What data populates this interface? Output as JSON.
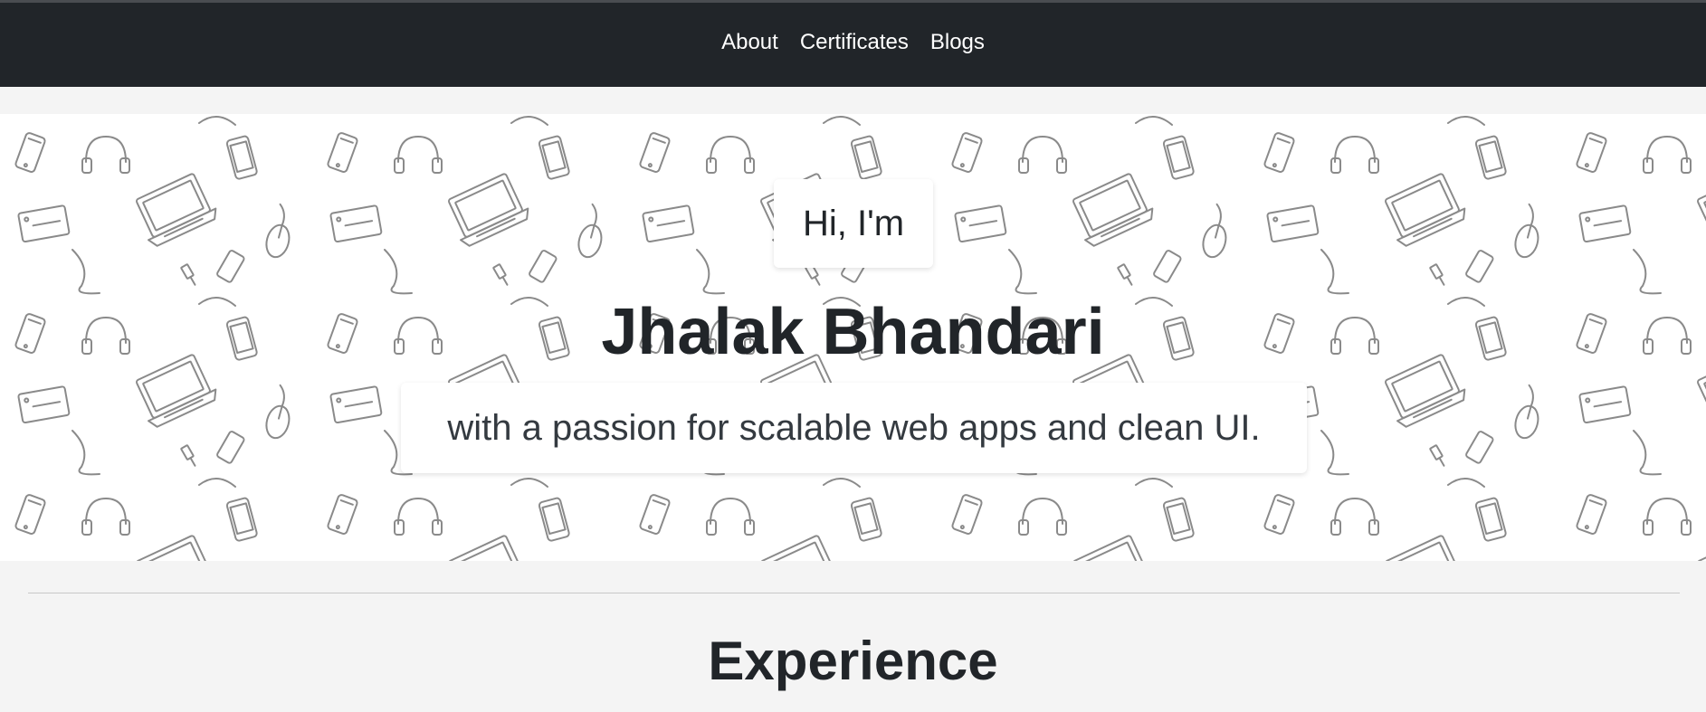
{
  "nav": {
    "links": [
      "About",
      "Certificates",
      "Blogs"
    ]
  },
  "hero": {
    "greeting": "Hi, I'm",
    "name": "Jhalak Bhandari",
    "tagline": "with a passion for scalable web apps and clean UI.",
    "background": "doodle-tech-pattern"
  },
  "sections": {
    "experience_title": "Experience"
  },
  "colors": {
    "navbar_bg": "#212529",
    "page_bg": "#f4f4f4",
    "text_dark": "#212529",
    "pattern_stroke": "#8a8a8a"
  }
}
